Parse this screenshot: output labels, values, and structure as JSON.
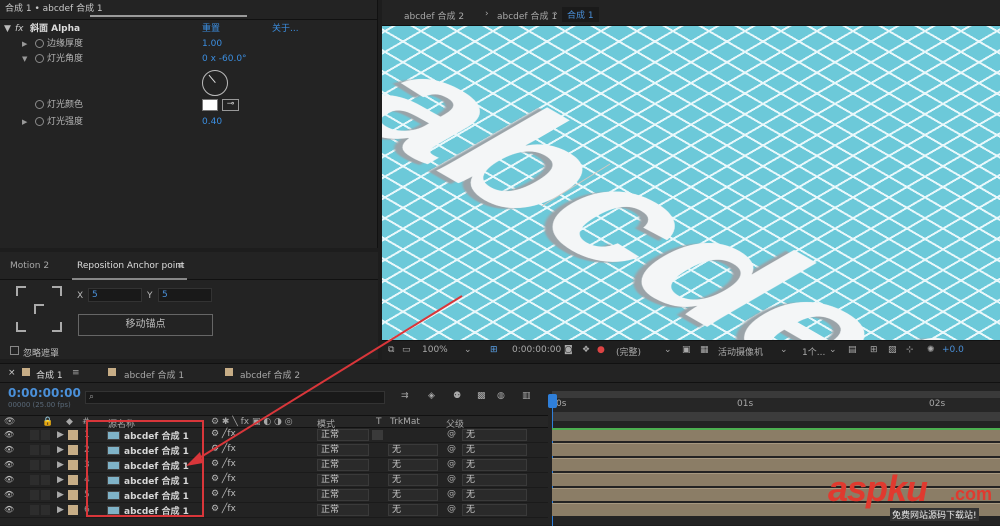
{
  "effect_controls": {
    "header": "合成 1 • abcdef 合成 1",
    "effect_name": "斜面 Alpha",
    "reset": "重置",
    "about": "关于...",
    "params": [
      {
        "label": "边缘厚度",
        "value": "1.00"
      },
      {
        "label": "灯光角度",
        "value": "0 x -60.0°"
      },
      {
        "label": "灯光颜色",
        "value": ""
      },
      {
        "label": "灯光强度",
        "value": "0.40"
      }
    ]
  },
  "reposition": {
    "tab1": "Motion 2",
    "tab2": "Reposition Anchor point",
    "x_label": "X",
    "x_value": "5",
    "y_label": "Y",
    "y_value": "5",
    "button": "移动锚点",
    "checkbox": "忽略遮罩"
  },
  "viewer": {
    "breadcrumbs": [
      "abcdef 合成 2",
      "abcdef 合成 1",
      "合成 1"
    ],
    "zoom": "100%",
    "timecode": "0:00:00:00",
    "quality": "(完整)",
    "camera": "活动摄像机",
    "views": "1个...",
    "exposure": "+0.0",
    "canvas_text": "abcdef"
  },
  "timeline": {
    "tabs": [
      "合成 1",
      "abcdef 合成 1",
      "abcdef 合成 2"
    ],
    "timecode": "0:00:00:00",
    "fps": "00000 (25.00 fps)",
    "columns": {
      "source": "源名称",
      "mode": "模式",
      "t": "T",
      "trkmat": "TrkMat",
      "parent": "父级"
    },
    "ruler": [
      "0s",
      "01s",
      "02s"
    ],
    "layers": [
      {
        "num": "1",
        "name": "abcdef 合成 1",
        "mode": "正常",
        "trkmat": "",
        "parent": "无"
      },
      {
        "num": "2",
        "name": "abcdef 合成 1",
        "mode": "正常",
        "trkmat": "无",
        "parent": "无"
      },
      {
        "num": "3",
        "name": "abcdef 合成 1",
        "mode": "正常",
        "trkmat": "无",
        "parent": "无"
      },
      {
        "num": "4",
        "name": "abcdef 合成 1",
        "mode": "正常",
        "trkmat": "无",
        "parent": "无"
      },
      {
        "num": "5",
        "name": "abcdef 合成 1",
        "mode": "正常",
        "trkmat": "无",
        "parent": "无"
      },
      {
        "num": "6",
        "name": "abcdef 合成 1",
        "mode": "正常",
        "trkmat": "无",
        "parent": "无"
      }
    ]
  },
  "watermark": {
    "main": "aspku",
    "suffix": ".com",
    "sub": "免费网站源码下载站!"
  }
}
